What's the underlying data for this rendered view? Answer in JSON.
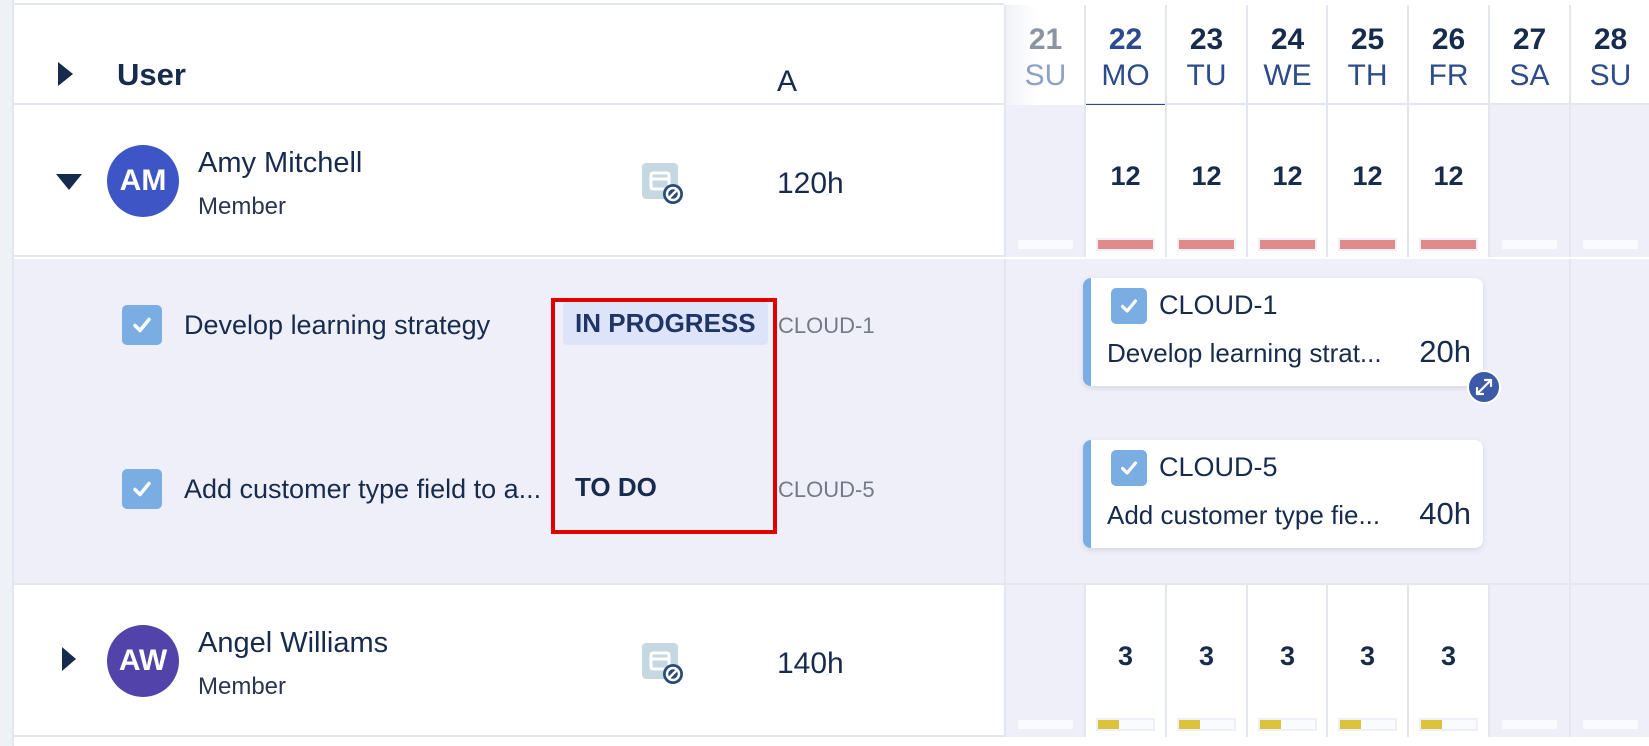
{
  "header": {
    "user_column_label": "User",
    "a_column_label": "A"
  },
  "days": [
    {
      "num": "21",
      "dow": "SU",
      "state": "past"
    },
    {
      "num": "22",
      "dow": "MO",
      "state": "today"
    },
    {
      "num": "23",
      "dow": "TU",
      "state": "normal"
    },
    {
      "num": "24",
      "dow": "WE",
      "state": "normal"
    },
    {
      "num": "25",
      "dow": "TH",
      "state": "normal"
    },
    {
      "num": "26",
      "dow": "FR",
      "state": "normal"
    },
    {
      "num": "27",
      "dow": "SA",
      "state": "normal"
    },
    {
      "num": "28",
      "dow": "SU",
      "state": "normal"
    }
  ],
  "users": [
    {
      "initials": "AM",
      "name": "Amy Mitchell",
      "role": "Member",
      "hours": "120h",
      "avatar_color": "#3e55c6",
      "expanded": true,
      "daily": [
        "",
        "12",
        "12",
        "12",
        "12",
        "12",
        "",
        ""
      ],
      "load_fraction": [
        0,
        1,
        1,
        1,
        1,
        1,
        0,
        0
      ],
      "load_color": "#e08a8a"
    },
    {
      "initials": "AW",
      "name": "Angel Williams",
      "role": "Member",
      "hours": "140h",
      "avatar_color": "#5243aa",
      "expanded": false,
      "daily": [
        "",
        "3",
        "3",
        "3",
        "3",
        "3",
        "",
        ""
      ],
      "load_fraction": [
        0,
        0.375,
        0.375,
        0.375,
        0.375,
        0.375,
        0,
        0
      ],
      "load_color": "#dcc33c"
    }
  ],
  "tasks": [
    {
      "title": "Develop learning strategy",
      "status": "IN PROGRESS",
      "key": "CLOUD-1",
      "card_title": "Develop learning strat...",
      "card_hours": "20h"
    },
    {
      "title": "Add customer type field to a...",
      "status": "TO DO",
      "key": "CLOUD-5",
      "card_title": "Add customer type fie...",
      "card_hours": "40h"
    }
  ],
  "colors": {
    "accent": "#2c4a8e",
    "highlight": "#e00000",
    "checkbox": "#7aaee3"
  }
}
